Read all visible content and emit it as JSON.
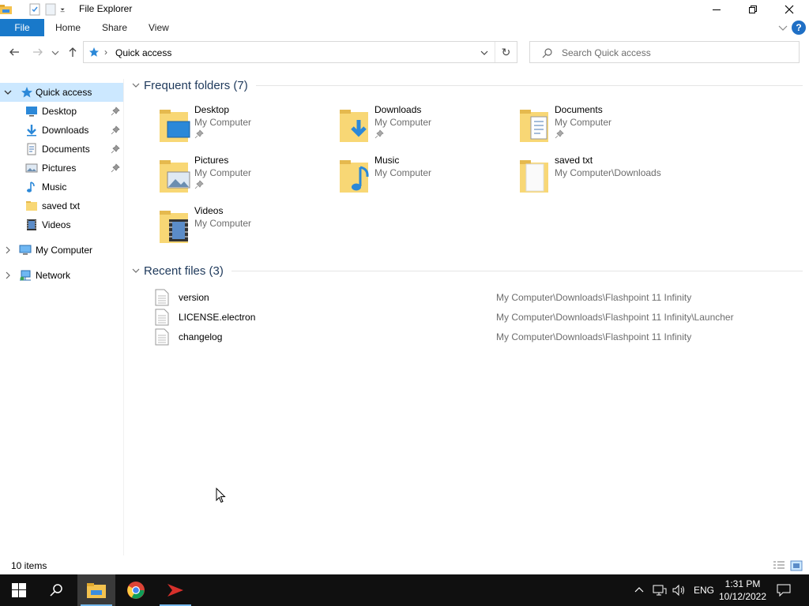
{
  "window": {
    "title": "File Explorer"
  },
  "ribbon": {
    "tabs": [
      {
        "label": "File"
      },
      {
        "label": "Home"
      },
      {
        "label": "Share"
      },
      {
        "label": "View"
      }
    ],
    "help_label": "?"
  },
  "address": {
    "crumb": "Quick access",
    "separator": "›",
    "refresh_glyph": "↻"
  },
  "search": {
    "placeholder": "Search Quick access"
  },
  "navpane": {
    "quick_access": "Quick access",
    "items": [
      {
        "label": "Desktop",
        "icon": "desktop-icon",
        "pinned": true
      },
      {
        "label": "Downloads",
        "icon": "downloads-icon",
        "pinned": true
      },
      {
        "label": "Documents",
        "icon": "documents-icon",
        "pinned": true
      },
      {
        "label": "Pictures",
        "icon": "pictures-icon",
        "pinned": true
      },
      {
        "label": "Music",
        "icon": "music-icon",
        "pinned": false
      },
      {
        "label": "saved txt",
        "icon": "folder-icon",
        "pinned": false
      },
      {
        "label": "Videos",
        "icon": "videos-icon",
        "pinned": false
      }
    ],
    "my_computer": "My Computer",
    "network": "Network"
  },
  "frequent": {
    "header": "Frequent folders (7)",
    "folders": [
      {
        "name": "Desktop",
        "location": "My Computer",
        "pinned": true,
        "overlay": "desktop"
      },
      {
        "name": "Downloads",
        "location": "My Computer",
        "pinned": true,
        "overlay": "downloads"
      },
      {
        "name": "Documents",
        "location": "My Computer",
        "pinned": true,
        "overlay": "documents"
      },
      {
        "name": "Pictures",
        "location": "My Computer",
        "pinned": true,
        "overlay": "pictures"
      },
      {
        "name": "Music",
        "location": "My Computer",
        "pinned": false,
        "overlay": "music"
      },
      {
        "name": "saved txt",
        "location": "My Computer\\Downloads",
        "pinned": false,
        "overlay": "plain"
      },
      {
        "name": "Videos",
        "location": "My Computer",
        "pinned": false,
        "overlay": "videos"
      }
    ]
  },
  "recent": {
    "header": "Recent files (3)",
    "files": [
      {
        "name": "version",
        "path": "My Computer\\Downloads\\Flashpoint 11 Infinity"
      },
      {
        "name": "LICENSE.electron",
        "path": "My Computer\\Downloads\\Flashpoint 11 Infinity\\Launcher"
      },
      {
        "name": "changelog",
        "path": "My Computer\\Downloads\\Flashpoint 11 Infinity"
      }
    ]
  },
  "status": {
    "items_count": "10 items"
  },
  "taskbar": {
    "language": "ENG",
    "time": "1:31 PM",
    "date": "10/12/2022"
  },
  "colors": {
    "accent": "#1979ca",
    "selection": "#cce8ff",
    "folder": "#f8d775",
    "group_header": "#1e395b"
  }
}
